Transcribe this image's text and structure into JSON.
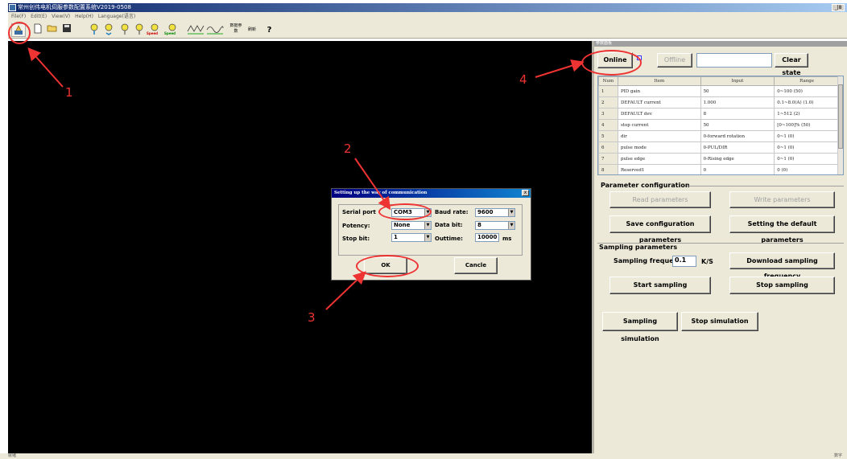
{
  "window": {
    "title": "常州创伟电机伺服参数配置系统V2019-0508",
    "maximize_label": "_|8"
  },
  "menu": [
    "File(F)",
    "Edit(E)",
    "View(V)",
    "Help(H)",
    "Language(语言)"
  ],
  "toolbar": {
    "speed_label_1": "Speed",
    "speed_label_2": "Speed",
    "chinese_btn_1": "数据参数",
    "chinese_btn_2": "刷新",
    "help_label": "?"
  },
  "right_panel": {
    "title": "参数面板",
    "online_label": "Online",
    "offline_label": "Offline",
    "state_value": "",
    "clear_state_label": "Clear state",
    "table": {
      "headers": [
        "Num",
        "Item",
        "Input",
        "Range"
      ],
      "rows": [
        [
          "1",
          "PID gain",
          "50",
          "0~100 (50)"
        ],
        [
          "2",
          "DEFAULT current",
          "1.000",
          "0.1~8.0(A) (1.0)"
        ],
        [
          "3",
          "DEFAULT dev",
          "8",
          "1~512 (2)"
        ],
        [
          "4",
          "stop current",
          "50",
          "[0~100]% (50)"
        ],
        [
          "5",
          "dir",
          "0-forward rotation",
          "0~1 (0)"
        ],
        [
          "6",
          "pulse mode",
          "0-PUL/DIR",
          "0~1 (0)"
        ],
        [
          "7",
          "pulse edge",
          "0-Rising edge",
          "0~1 (0)"
        ],
        [
          "8",
          "Reserved1",
          "0",
          "0 (0)"
        ]
      ]
    },
    "param_config": {
      "title": "Parameter configuration",
      "read_label": "Read parameters",
      "write_label": "Write parameters",
      "save_label": "Save configuration parameters",
      "default_label": "Setting the default parameters"
    },
    "sampling": {
      "title": "Sampling parameters",
      "frequency_label": "Sampling frequency",
      "frequency_value": "0.1",
      "unit": "K/S",
      "download_label": "Download sampling frequency",
      "start_label": "Start sampling",
      "stop_label": "Stop sampling",
      "sim_label": "Sampling simulation",
      "stop_sim_label": "Stop simulation"
    }
  },
  "dialog": {
    "title": "Setting up the way of communication",
    "close_label": "x",
    "serial_port_label": "Serial port",
    "serial_port_value": "COM3",
    "baud_rate_label": "Baud rate:",
    "baud_rate_value": "9600",
    "potency_label": "Potency:",
    "potency_value": "None",
    "data_bit_label": "Data bit:",
    "data_bit_value": "8",
    "stop_bit_label": "Stop bit:",
    "stop_bit_value": "1",
    "outtime_label": "Outtime:",
    "outtime_value": "10000",
    "outtime_unit": "ms",
    "ok_label": "OK",
    "cancel_label": "Cancle"
  },
  "annotations": {
    "label_1": "1",
    "label_2": "2",
    "label_3": "3",
    "label_4": "4",
    "color": "#e33333"
  },
  "status": {
    "left": "就绪",
    "right": "数字"
  }
}
